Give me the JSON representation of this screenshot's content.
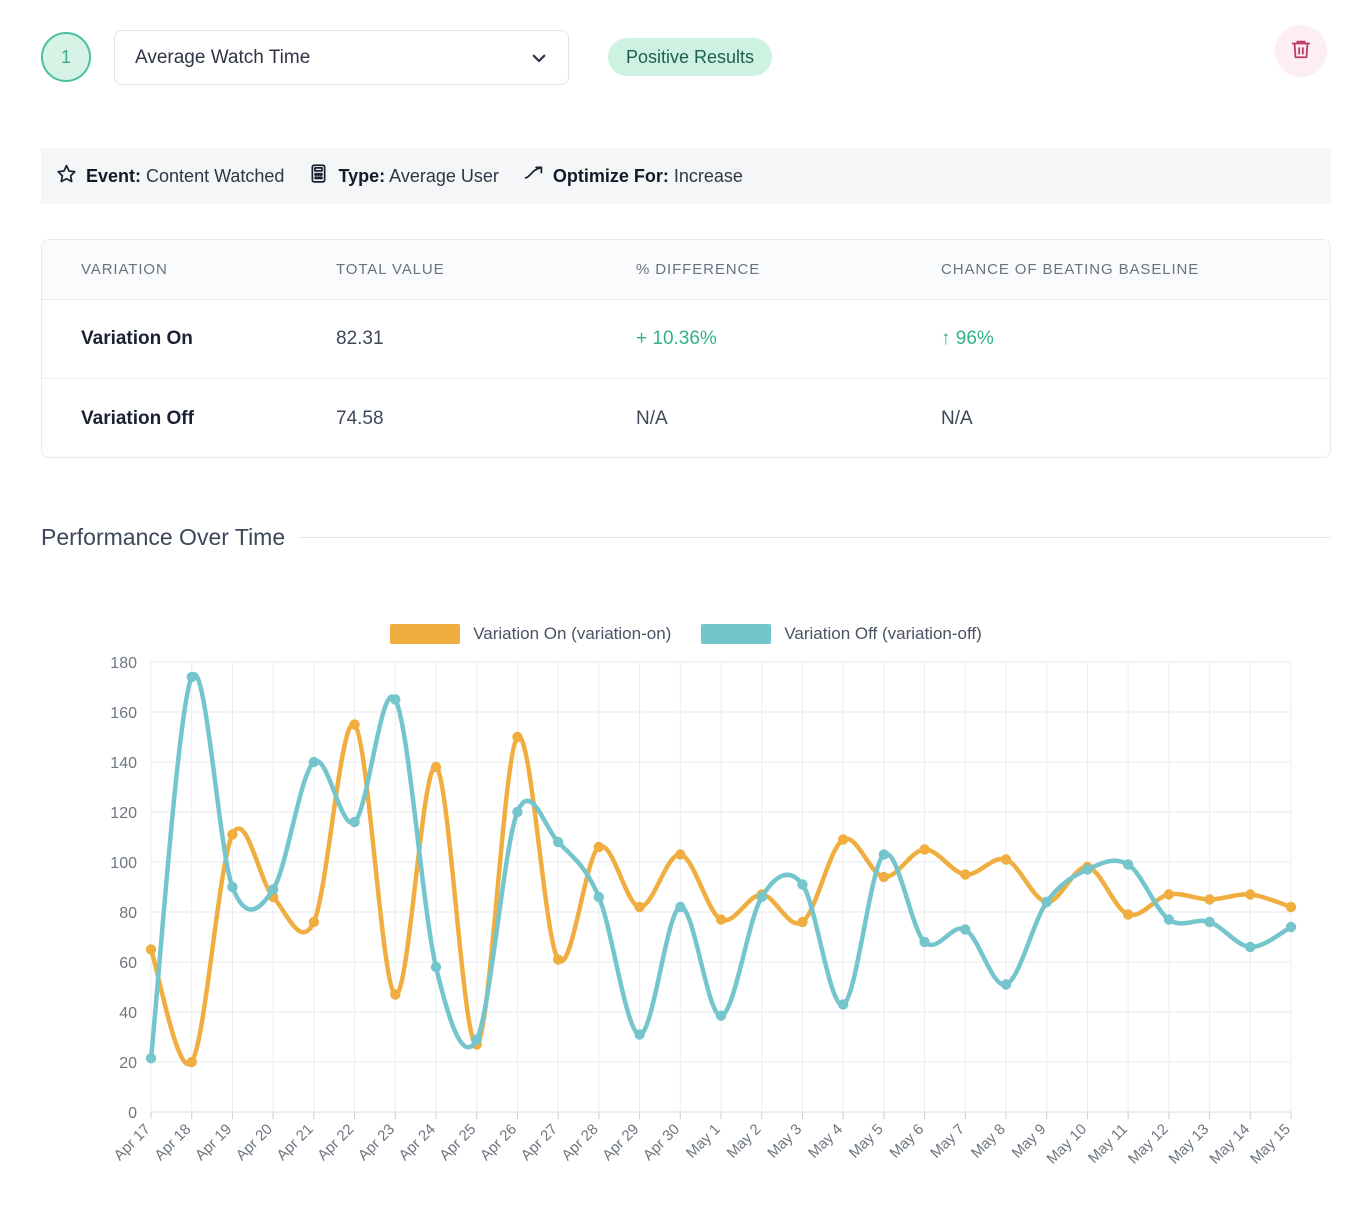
{
  "header": {
    "step_number": "1",
    "metric_label": "Average Watch Time",
    "dropdown_icon": "chevron-down-icon",
    "results_badge": "Positive Results",
    "delete_icon": "trash-icon",
    "accent_teal": "#4cbfa0",
    "badge_bg": "#cdf2e2",
    "delete_color": "#c0396a"
  },
  "meta": {
    "event_icon": "star-icon",
    "event_label": "Event:",
    "event_value": "Content Watched",
    "type_icon": "calculator-icon",
    "type_label": "Type:",
    "type_value": "Average User",
    "optimize_icon": "trending-up-icon",
    "optimize_label": "Optimize For:",
    "optimize_value": "Increase"
  },
  "table": {
    "columns": [
      "VARIATION",
      "TOTAL VALUE",
      "% DIFFERENCE",
      "CHANCE OF BEATING BASELINE"
    ],
    "rows": [
      {
        "variation": "Variation On",
        "total_value": "82.31",
        "pct_difference": "+ 10.36%",
        "chance": "↑ 96%",
        "positive": true
      },
      {
        "variation": "Variation Off",
        "total_value": "74.58",
        "pct_difference": "N/A",
        "chance": "N/A",
        "positive": false
      }
    ]
  },
  "section": {
    "title": "Performance Over Time"
  },
  "chart_data": {
    "type": "line",
    "title": "Performance Over Time",
    "xlabel": "",
    "ylabel": "",
    "ylim": [
      0,
      180
    ],
    "yticks": [
      0,
      20,
      40,
      60,
      80,
      100,
      120,
      140,
      160,
      180
    ],
    "grid": true,
    "legend_position": "top-center",
    "colors": {
      "variation_on": "#efae3f",
      "variation_off": "#74c5cc"
    },
    "categories": [
      "Apr 17",
      "Apr 18",
      "Apr 19",
      "Apr 20",
      "Apr 21",
      "Apr 22",
      "Apr 23",
      "Apr 24",
      "Apr 25",
      "Apr 26",
      "Apr 27",
      "Apr 28",
      "Apr 29",
      "Apr 30",
      "May 1",
      "May 2",
      "May 3",
      "May 4",
      "May 5",
      "May 6",
      "May 7",
      "May 8",
      "May 9",
      "May 10",
      "May 11",
      "May 12",
      "May 13",
      "May 14",
      "May 15"
    ],
    "series": [
      {
        "name": "Variation On (variation-on)",
        "key": "variation-on",
        "color": "#efae3f",
        "values": [
          65,
          20,
          111,
          86,
          76,
          155,
          47,
          138,
          27,
          150,
          61,
          106,
          82,
          103,
          77,
          87,
          76,
          109,
          94,
          105,
          95,
          101,
          84,
          98,
          79,
          87,
          85,
          87,
          82
        ]
      },
      {
        "name": "Variation Off (variation-off)",
        "key": "variation-off",
        "color": "#74c5cc",
        "values": [
          21.5,
          174,
          90,
          89,
          140,
          116,
          165,
          58,
          29,
          120,
          108,
          86,
          31,
          82,
          38.5,
          86,
          91,
          43,
          103,
          68,
          73,
          51,
          84,
          97,
          99,
          77,
          76,
          66,
          74
        ]
      }
    ]
  }
}
